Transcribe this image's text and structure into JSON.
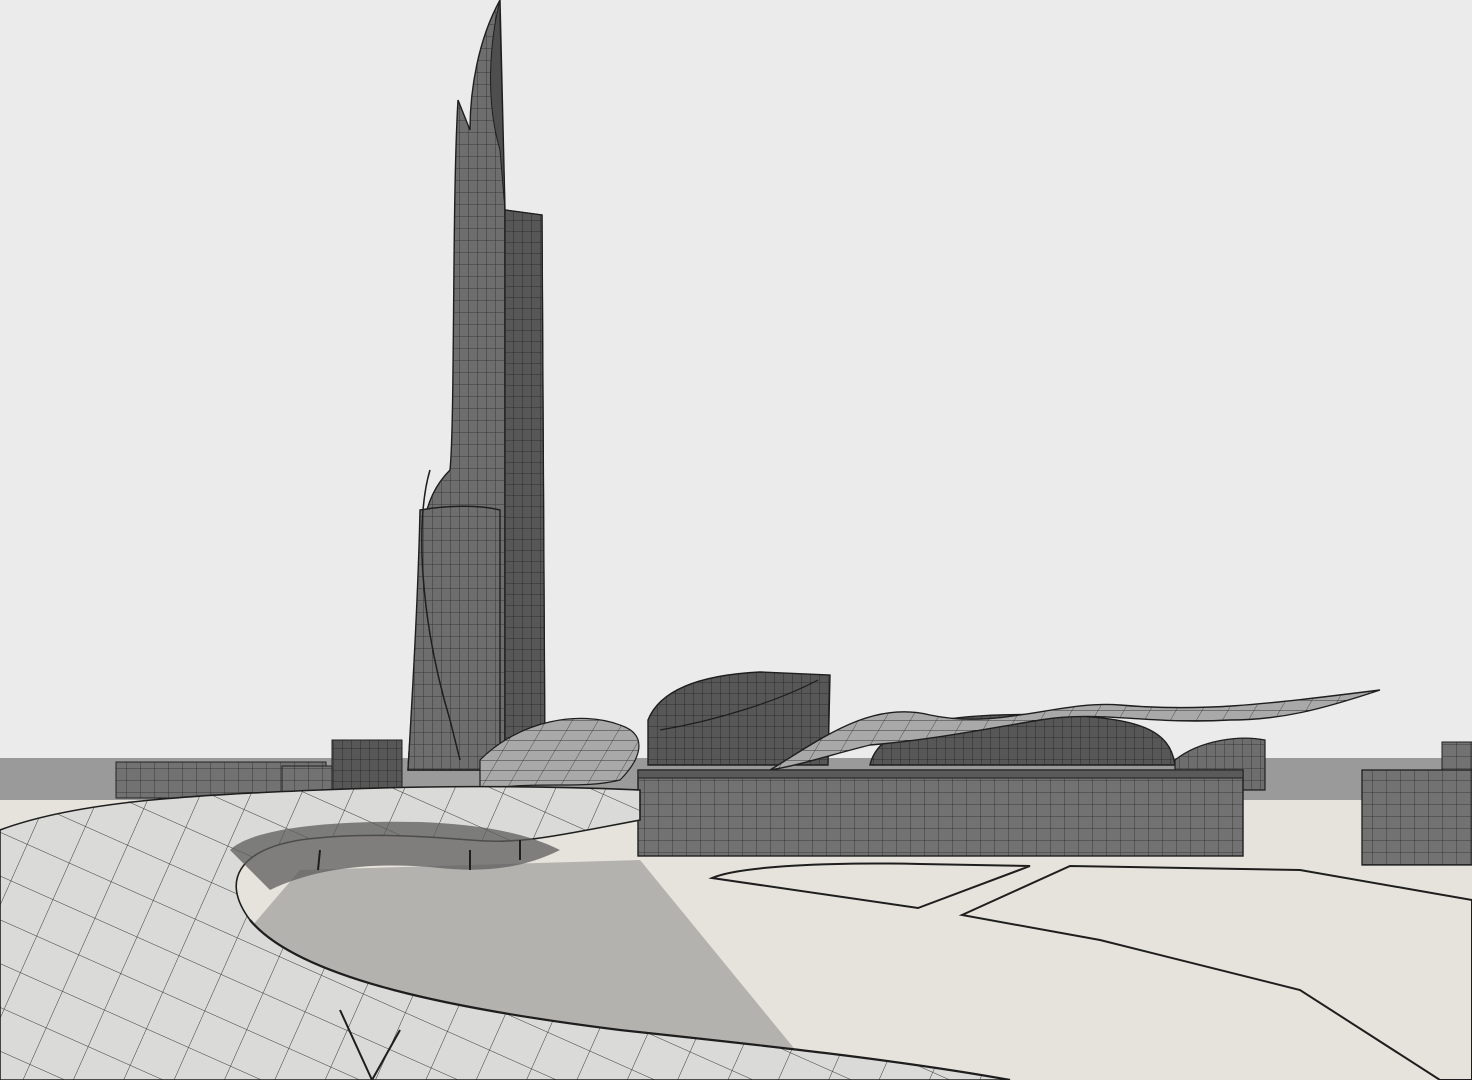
{
  "scene": {
    "subject": "architectural-wireframe-render",
    "colors": {
      "sky": "#ebebeb",
      "ground": "#e6e3dc",
      "facade": "#6e6e6e",
      "facade_dark": "#4f4f4f",
      "line": "#1e1e1e",
      "roof": "#a9a9a9",
      "canopy": "#d9d9d7",
      "shadow": "#7f7f7f"
    }
  }
}
